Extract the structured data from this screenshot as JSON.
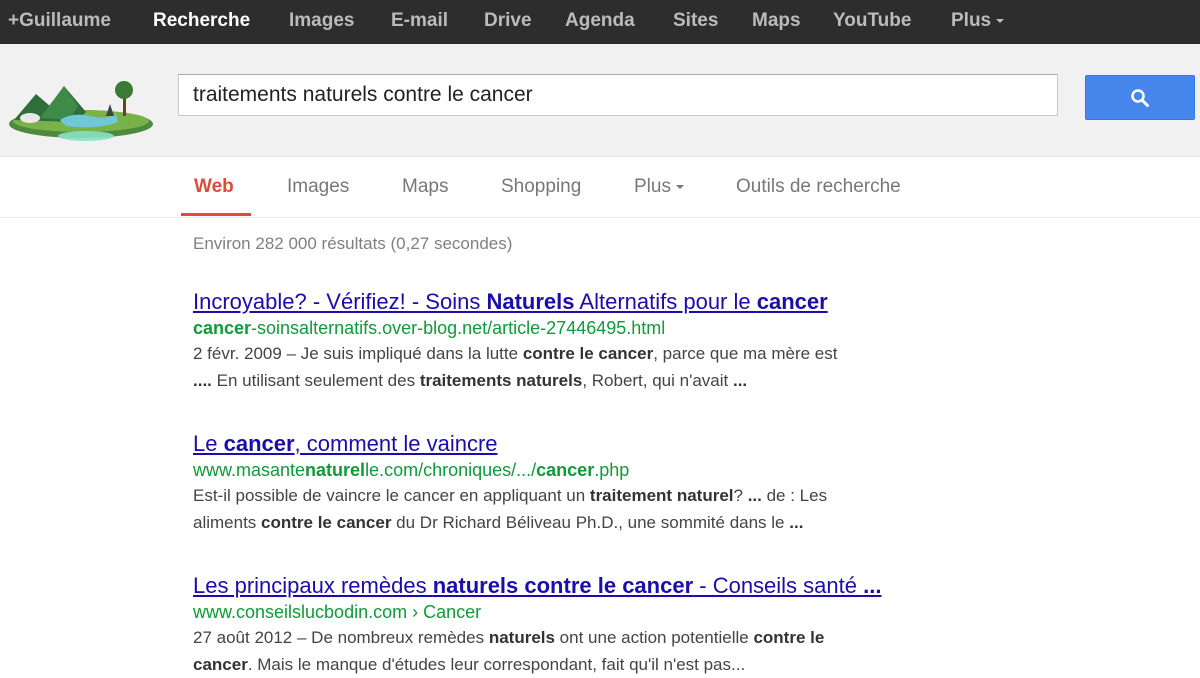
{
  "topbar": {
    "items": [
      {
        "label": "+Guillaume",
        "active": false
      },
      {
        "label": "Recherche",
        "active": true
      },
      {
        "label": "Images",
        "active": false
      },
      {
        "label": "E-mail",
        "active": false
      },
      {
        "label": "Drive",
        "active": false
      },
      {
        "label": "Agenda",
        "active": false
      },
      {
        "label": "Sites",
        "active": false
      },
      {
        "label": "Maps",
        "active": false
      },
      {
        "label": "YouTube",
        "active": false
      },
      {
        "label": "Plus",
        "active": false
      }
    ]
  },
  "search": {
    "query": "traitements naturels contre le cancer",
    "button_icon": "search-icon",
    "button_color": "#4787ed"
  },
  "tabs": {
    "items": [
      {
        "label": "Web",
        "active": true
      },
      {
        "label": "Images",
        "active": false
      },
      {
        "label": "Maps",
        "active": false
      },
      {
        "label": "Shopping",
        "active": false
      },
      {
        "label": "Plus",
        "active": false
      },
      {
        "label": "Outils de recherche",
        "active": false
      }
    ],
    "active_color": "#dd4b39"
  },
  "stats": "Environ 282 000 résultats (0,27 secondes)",
  "results": [
    {
      "title": [
        {
          "t": "Incroyable? - Vérifiez! - Soins "
        },
        {
          "t": "Naturels",
          "b": true
        },
        {
          "t": " Alternatifs pour le "
        },
        {
          "t": "cancer",
          "b": true
        }
      ],
      "url": [
        {
          "t": "cancer",
          "b": true
        },
        {
          "t": "-soinsalternatifs.over-blog.net/article-27446495.html"
        }
      ],
      "snippet": [
        [
          {
            "t": "2 févr. 2009 – Je suis impliqué dans la lutte "
          },
          {
            "t": "contre le cancer",
            "b": true
          },
          {
            "t": ", parce que ma mère est"
          }
        ],
        [
          {
            "t": "....",
            "b": true
          },
          {
            "t": " En utilisant seulement des "
          },
          {
            "t": "traitements naturels",
            "b": true
          },
          {
            "t": ", Robert, qui n'avait "
          },
          {
            "t": "...",
            "b": true
          }
        ]
      ]
    },
    {
      "title": [
        {
          "t": "Le "
        },
        {
          "t": "cancer",
          "b": true
        },
        {
          "t": ", comment le vaincre"
        }
      ],
      "url": [
        {
          "t": "www.masante"
        },
        {
          "t": "naturel",
          "b": true
        },
        {
          "t": "le.com/chroniques/.../"
        },
        {
          "t": "cancer",
          "b": true
        },
        {
          "t": ".php"
        }
      ],
      "snippet": [
        [
          {
            "t": "Est-il possible de vaincre le cancer en appliquant un "
          },
          {
            "t": "traitement naturel",
            "b": true
          },
          {
            "t": "? "
          },
          {
            "t": "...",
            "b": true
          },
          {
            "t": " de : Les"
          }
        ],
        [
          {
            "t": "aliments "
          },
          {
            "t": "contre le cancer",
            "b": true
          },
          {
            "t": " du Dr Richard Béliveau Ph.D., une sommité dans le "
          },
          {
            "t": "...",
            "b": true
          }
        ]
      ]
    },
    {
      "title": [
        {
          "t": "Les principaux remèdes "
        },
        {
          "t": "naturels contre le cancer",
          "b": true
        },
        {
          "t": " - Conseils santé "
        },
        {
          "t": "...",
          "b": true
        }
      ],
      "url": [
        {
          "t": "www.conseilslucbodin.com › Cancer"
        }
      ],
      "snippet": [
        [
          {
            "t": "27 août 2012 – De nombreux remèdes "
          },
          {
            "t": "naturels",
            "b": true
          },
          {
            "t": " ont une action potentielle "
          },
          {
            "t": "contre le",
            "b": true
          }
        ],
        [
          {
            "t": "cancer",
            "b": true
          },
          {
            "t": ". Mais le manque d'études leur correspondant, fait qu'il n'est pas..."
          }
        ]
      ]
    }
  ]
}
